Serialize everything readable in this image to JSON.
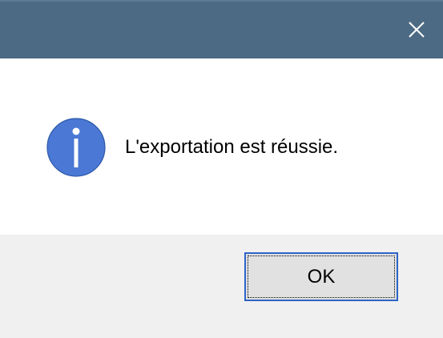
{
  "dialog": {
    "message": "L'exportation est réussie.",
    "icon": "info-icon",
    "ok_label": "OK",
    "close_icon": "close-icon"
  },
  "colors": {
    "titlebar": "#4d6a84",
    "icon_fill": "#4a78d4",
    "button_border": "#2d63c8",
    "footer": "#f0f0f0"
  }
}
